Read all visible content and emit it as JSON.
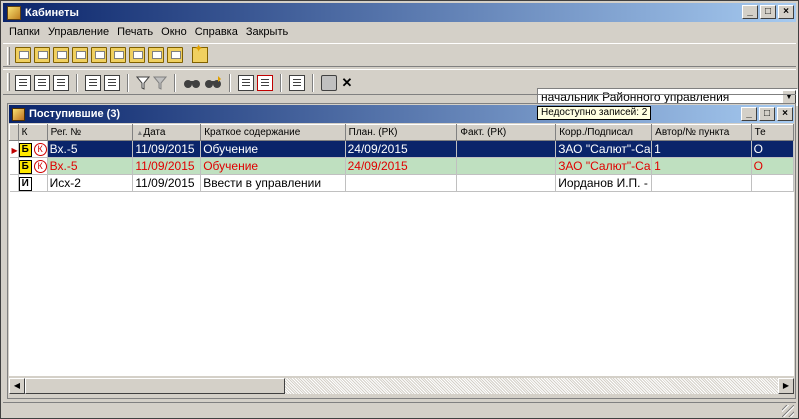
{
  "window": {
    "title": "Кабинеты"
  },
  "menu": [
    "Папки",
    "Управление",
    "Печать",
    "Окно",
    "Справка",
    "Закрыть"
  ],
  "role_select": {
    "value": "начальник Районного управления"
  },
  "child": {
    "title": "Поступившие (3)",
    "tooltip": "Недоступно записей: 2"
  },
  "table": {
    "columns": [
      "",
      "К",
      "Рег. №",
      "Дата",
      "Краткое содержание",
      "План. (РК)",
      "Факт. (РК)",
      "Корр./Подписал",
      "Автор/№ пункта",
      "Те"
    ],
    "rows": [
      {
        "reg": "Вх.-5",
        "date": "11/09/2015",
        "summary": "Обучение",
        "plan": "24/09/2015",
        "fact": "",
        "corr": "ЗАО \"Салют\"-Са",
        "author": "1",
        "te": "О"
      },
      {
        "reg": "Вх.-5",
        "date": "11/09/2015",
        "summary": "Обучение",
        "plan": "24/09/2015",
        "fact": "",
        "corr": "ЗАО \"Салют\"-Са",
        "author": "1",
        "te": "О"
      },
      {
        "reg": "Исх-2",
        "date": "11/09/2015",
        "summary": "Ввести в управлении",
        "plan": "",
        "fact": "",
        "corr": "Иорданов И.П. -",
        "author": "",
        "te": ""
      }
    ]
  },
  "icons": {
    "app": "cabinet-icon",
    "badge_b": "Б",
    "badge_k": "К",
    "badge_i": "И"
  }
}
